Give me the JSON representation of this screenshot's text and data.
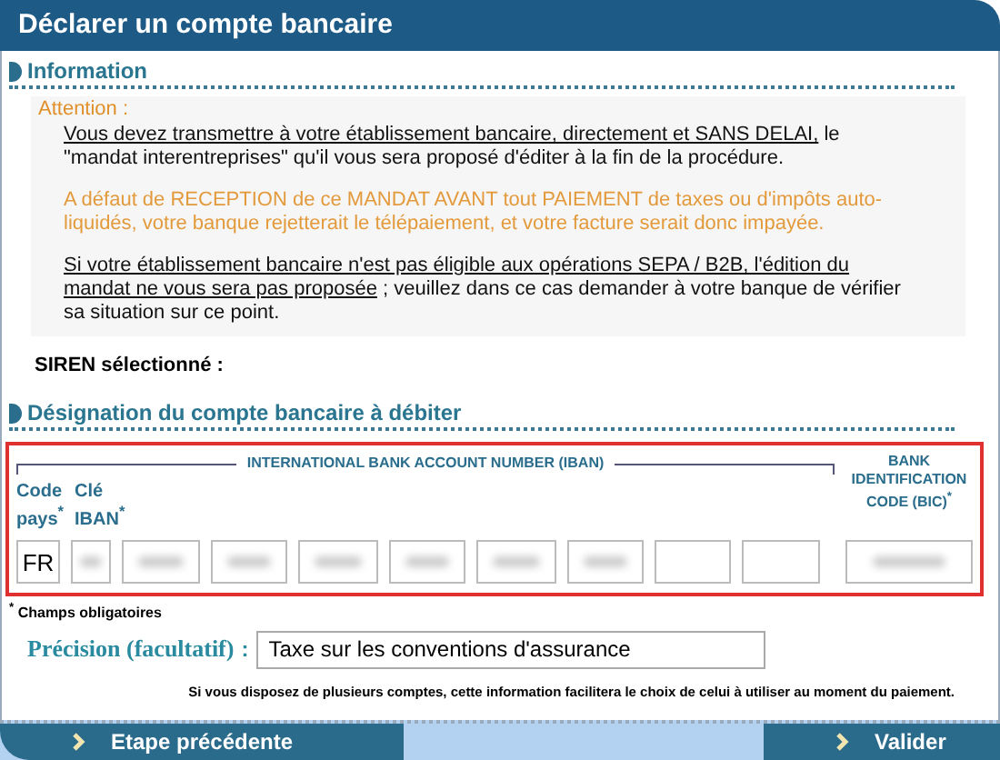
{
  "window": {
    "title": "Déclarer un compte bancaire"
  },
  "information": {
    "heading": "Information",
    "attention_label": "Attention :",
    "paragraphs": [
      {
        "kind": "underlined",
        "underlined": "Vous devez transmettre à votre établissement bancaire, directement et SANS DELAI,",
        "rest": "le \"mandat interentreprises\" qu'il vous sera proposé d'éditer à la fin de la procédure."
      },
      {
        "kind": "warning",
        "text": "A défaut de RECEPTION de ce MANDAT AVANT tout PAIEMENT de taxes ou d'impôts auto-liquidés, votre banque rejetterait le télépaiement, et votre facture serait donc impayée."
      },
      {
        "kind": "underlined",
        "underlined": "Si votre établissement bancaire n'est pas éligible aux opérations SEPA / B2B, l'édition du mandat ne vous sera pas proposée",
        "rest": "; veuillez dans ce cas demander à votre banque de vérifier sa situation sur ce point."
      }
    ]
  },
  "siren_label": "SIREN sélectionné :",
  "account": {
    "heading": "Désignation du compte bancaire à débiter",
    "iban_group": "INTERNATIONAL BANK ACCOUNT NUMBER (IBAN)",
    "bic_group": "BANK IDENTIFICATION CODE (BIC)",
    "country_label": "Code pays",
    "key_label": "Clé IBAN",
    "required_mark": "*",
    "country_value": "FR",
    "iban_fields": [
      {
        "redacted": true
      },
      {
        "redacted": true
      },
      {
        "redacted": true
      },
      {
        "redacted": true
      },
      {
        "redacted": true
      },
      {
        "redacted": true
      },
      {
        "redacted": true
      },
      {
        "redacted": false
      },
      {
        "redacted": false
      }
    ],
    "bic_field": {
      "redacted": true
    }
  },
  "required_note": "Champs obligatoires",
  "precision": {
    "label": "Précision (facultatif)",
    "colon": ":",
    "value": "Taxe sur les conventions d'assurance",
    "hint": "Si vous disposez de plusieurs comptes, cette information facilitera le choix de celui à utiliser au moment du paiement."
  },
  "footer": {
    "back": "Etape précédente",
    "next": "Valider"
  }
}
